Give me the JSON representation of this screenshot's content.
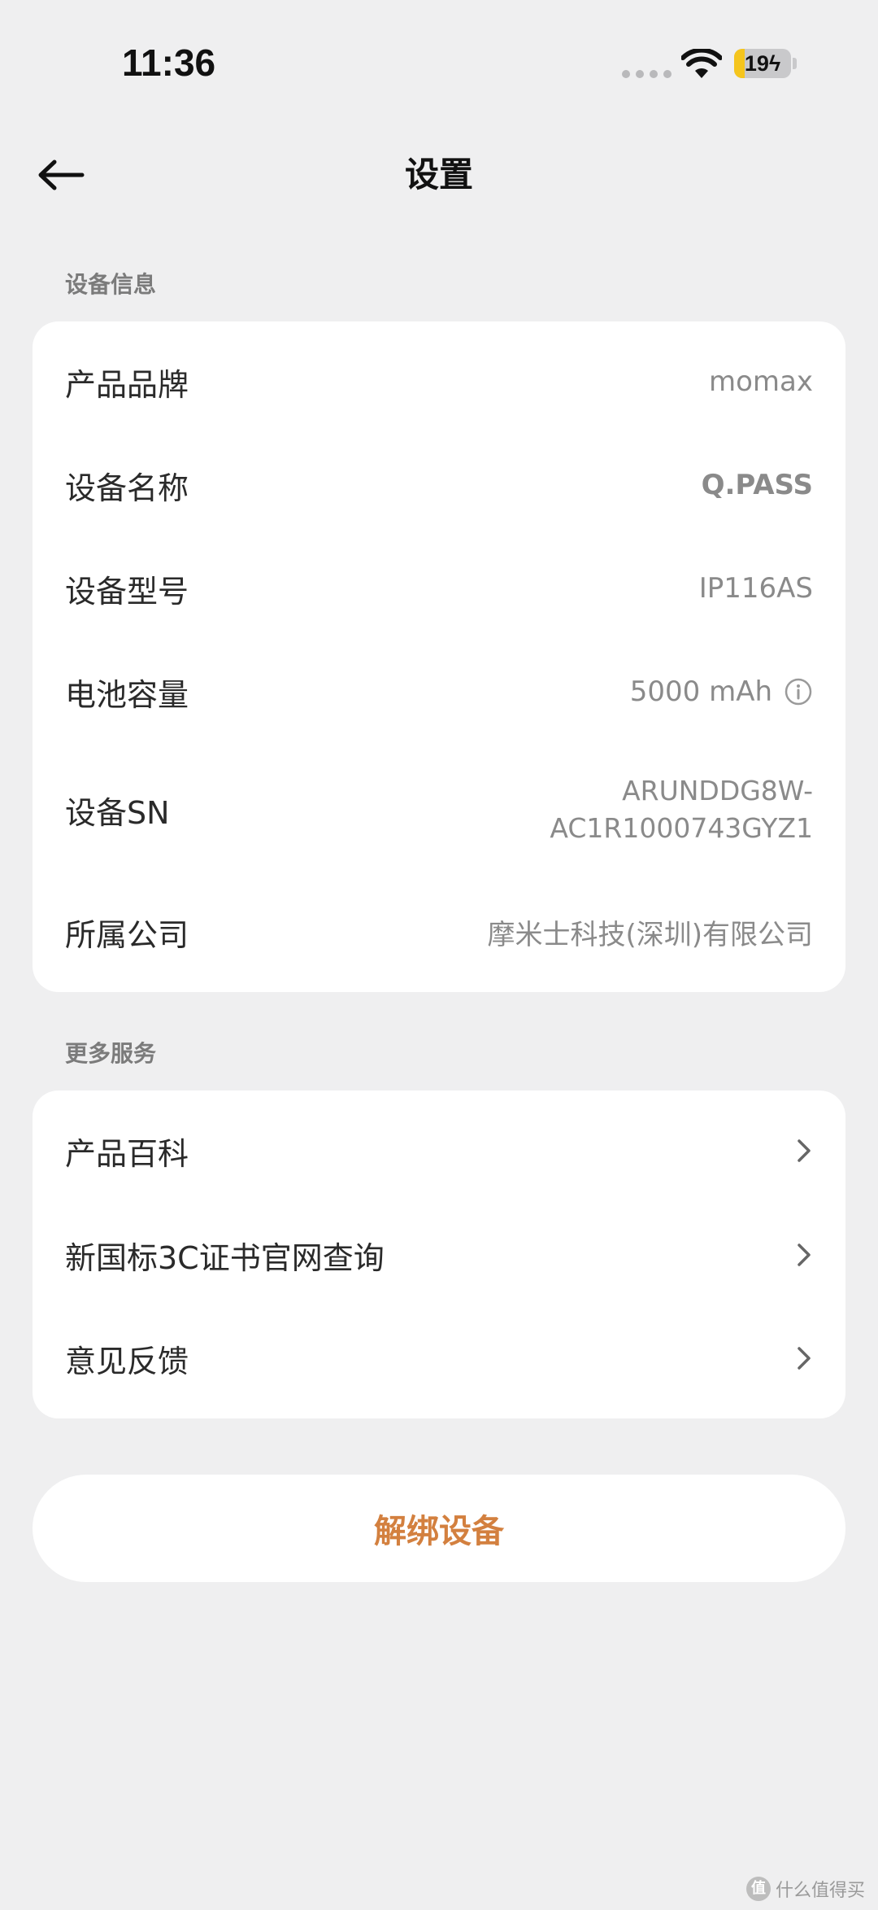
{
  "status_bar": {
    "time": "11:36",
    "battery_level": "19",
    "battery_fraction": 0.19,
    "battery_charging": true,
    "battery_color": "#f5c51d",
    "wifi_icon": "wifi-icon"
  },
  "nav": {
    "back_icon": "arrow-left-icon",
    "title": "设置"
  },
  "device_info": {
    "section_title": "设备信息",
    "rows": [
      {
        "label": "产品品牌",
        "value": "momax"
      },
      {
        "label": "设备名称",
        "value": "Q.PASS"
      },
      {
        "label": "设备型号",
        "value": "IP116AS"
      },
      {
        "label": "电池容量",
        "value": "5000 mAh",
        "icon": "info-circle-icon"
      },
      {
        "label": "设备SN",
        "value_line1": "ARUNDDG8W-",
        "value_line2": "AC1R1000743GYZ1"
      },
      {
        "label": "所属公司",
        "value": "摩米士科技(深圳)有限公司"
      }
    ]
  },
  "more_services": {
    "section_title": "更多服务",
    "rows": [
      {
        "label": "产品百科",
        "icon": "chevron-right-icon"
      },
      {
        "label": "新国标3C证书官网查询",
        "icon": "chevron-right-icon"
      },
      {
        "label": "意见反馈",
        "icon": "chevron-right-icon"
      }
    ]
  },
  "unbind_button": {
    "label": "解绑设备",
    "color": "#d3803f"
  },
  "watermark": {
    "logo_text": "值",
    "text": "什么值得买"
  }
}
